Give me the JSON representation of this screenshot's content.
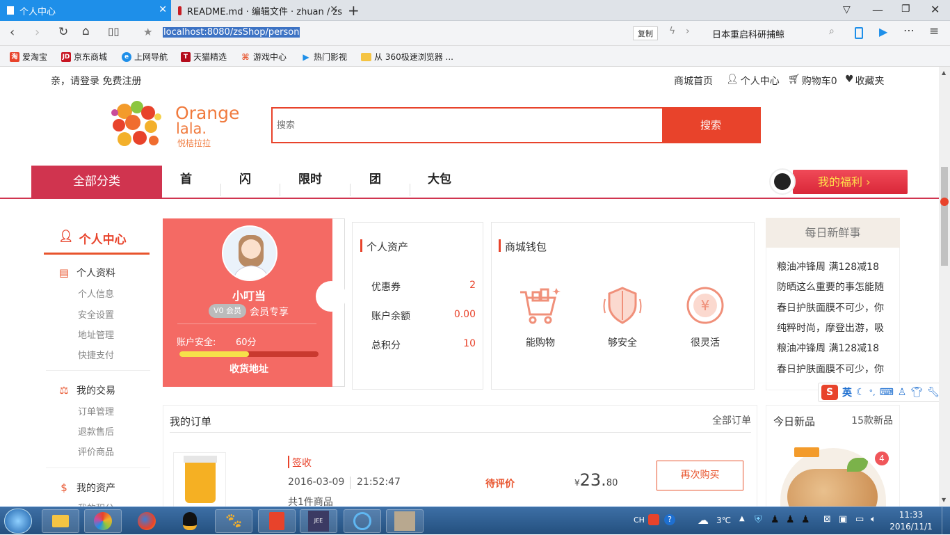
{
  "browser": {
    "tabs": [
      {
        "label": "个人中心"
      },
      {
        "label": "README.md · 编辑文件 · zhuan / zs"
      }
    ],
    "new_tab": "+",
    "address": "localhost:8080/zsShop/person",
    "copy_label": "复制",
    "search_suggestion": "日本重启科研捕鲸",
    "bookmarks": [
      {
        "label": "爱淘宝"
      },
      {
        "label": "京东商城"
      },
      {
        "label": "上网导航"
      },
      {
        "label": "天猫精选"
      },
      {
        "label": "游戏中心"
      },
      {
        "label": "热门影视"
      },
      {
        "label": "从 360极速浏览器 ..."
      }
    ]
  },
  "topbar": {
    "login_text": "亲，请登录 免费注册",
    "links": [
      "商城首页",
      "个人中心",
      "购物车0",
      "收藏夹"
    ]
  },
  "logo": {
    "name_line1": "Orange",
    "name_line2": "lala.",
    "name_cn": "悦桔拉拉"
  },
  "search": {
    "placeholder": "搜索",
    "button": "搜索"
  },
  "mainnav": {
    "all_categories": "全部分类",
    "items": [
      "首",
      "闪",
      "限时",
      "团",
      "大包"
    ],
    "welfare": "我的福利 ›"
  },
  "sidebar": {
    "title": "个人中心",
    "groups": [
      {
        "title": "个人资料",
        "items": [
          "个人信息",
          "安全设置",
          "地址管理",
          "快捷支付"
        ]
      },
      {
        "title": "我的交易",
        "items": [
          "订单管理",
          "退款售后",
          "评价商品"
        ]
      },
      {
        "title": "我的资产",
        "items": [
          "我的积分"
        ]
      }
    ]
  },
  "profile": {
    "username": "小叮当",
    "vip_badge": "V0 会员",
    "vip_text": "会员专享",
    "security_label": "账户安全:",
    "security_score": "60分",
    "security_progress": 0.5,
    "address_link": "收货地址"
  },
  "assets": {
    "title": "个人资产",
    "rows": [
      {
        "label": "优惠券",
        "value": "2"
      },
      {
        "label": "账户余额",
        "value": "0.00"
      },
      {
        "label": "总积分",
        "value": "10"
      }
    ]
  },
  "wallet": {
    "title": "商城钱包",
    "items": [
      "能购物",
      "够安全",
      "很灵活"
    ]
  },
  "daily": {
    "title": "每日新鲜事",
    "items": [
      "粮油冲锋周 满128减18",
      "防晒这么重要的事怎能随",
      "春日护肤面膜不可少，你",
      "纯粹时尚，摩登出游，吸",
      "粮油冲锋周 满128减18",
      "春日护肤面膜不可少，你"
    ]
  },
  "orders": {
    "title": "我的订单",
    "all_link": "全部订单",
    "order": {
      "status_tag": "签收",
      "date": "2016-03-09",
      "time": "21:52:47",
      "count": "共1件商品",
      "state": "待评价",
      "currency": "¥",
      "price_main": "23.",
      "price_decimal": "80",
      "rebuy": "再次购买"
    }
  },
  "new_products": {
    "title": "今日新品",
    "count": "15款新品",
    "badge": "4"
  },
  "ime": {
    "label": "英"
  },
  "taskbar": {
    "lang": "CH",
    "weather": "3℃",
    "time": "11:33",
    "date": "2016/11/1"
  },
  "colors": {
    "accent": "#e8432b",
    "nav_red": "#d0344f",
    "profile_bg": "#f46a64",
    "tab_blue": "#1e8fe9"
  }
}
